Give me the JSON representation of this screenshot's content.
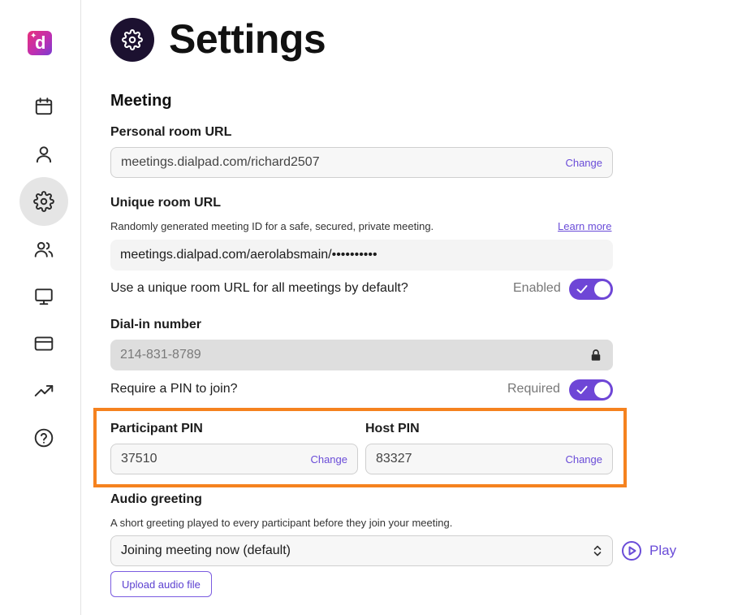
{
  "app": {
    "logo_letter": "d",
    "logo_spark": "✦"
  },
  "sidebar": {
    "items": [
      {
        "name": "calendar",
        "icon": "calendar-icon",
        "active": false
      },
      {
        "name": "profile",
        "icon": "user-icon",
        "active": false
      },
      {
        "name": "settings",
        "icon": "gear-icon",
        "active": true
      },
      {
        "name": "team",
        "icon": "users-icon",
        "active": false
      },
      {
        "name": "display",
        "icon": "monitor-icon",
        "active": false
      },
      {
        "name": "billing",
        "icon": "credit-card-icon",
        "active": false
      },
      {
        "name": "analytics",
        "icon": "trending-up-icon",
        "active": false
      },
      {
        "name": "help",
        "icon": "help-circle-icon",
        "active": false
      }
    ]
  },
  "header": {
    "title": "Settings",
    "icon": "gear-icon"
  },
  "meeting": {
    "section_title": "Meeting",
    "personal_room": {
      "label": "Personal room URL",
      "value": "meetings.dialpad.com/richard2507",
      "change_label": "Change"
    },
    "unique_room": {
      "label": "Unique room URL",
      "description": "Randomly generated meeting ID for a safe, secured, private meeting.",
      "learn_more": "Learn more",
      "value": "meetings.dialpad.com/aerolabsmain/••••••••••"
    },
    "unique_default": {
      "question": "Use a unique room URL for all meetings by default?",
      "status": "Enabled",
      "on": true
    },
    "dial_in": {
      "label": "Dial-in number",
      "value": "214-831-8789",
      "icon": "lock-icon"
    },
    "pin_required": {
      "question": "Require a PIN to join?",
      "status": "Required",
      "on": true
    },
    "participant_pin": {
      "label": "Participant PIN",
      "value": "37510",
      "change_label": "Change"
    },
    "host_pin": {
      "label": "Host PIN",
      "value": "83327",
      "change_label": "Change"
    },
    "audio_greeting": {
      "label": "Audio greeting",
      "description": "A short greeting played to every participant before they join your meeting.",
      "selected": "Joining meeting now (default)",
      "play_label": "Play",
      "upload_label": "Upload audio file"
    }
  },
  "colors": {
    "accent": "#6e46d6",
    "highlight": "#f5821f",
    "header_icon_bg": "#1c1130"
  }
}
